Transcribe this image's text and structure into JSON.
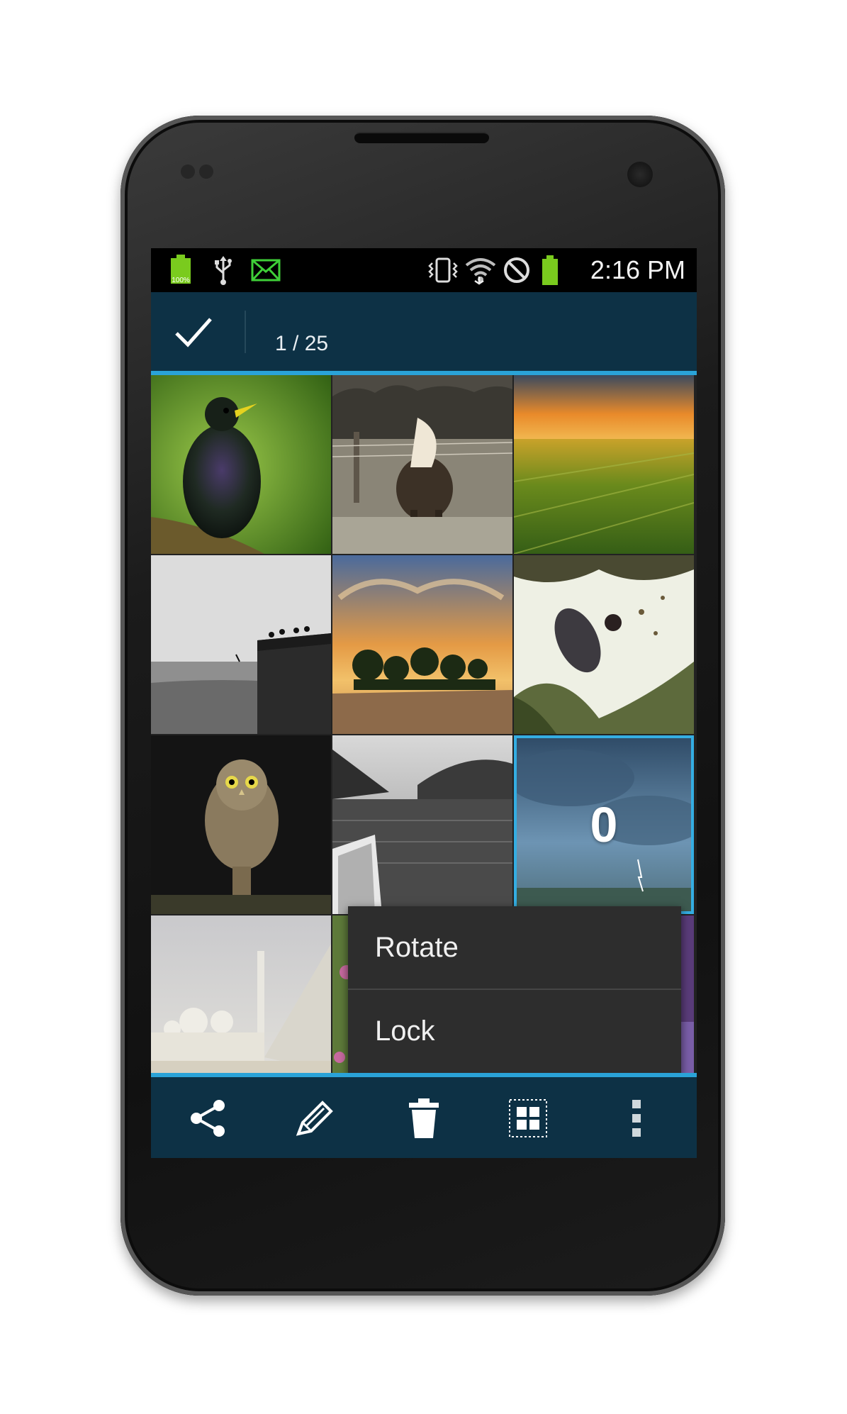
{
  "status_bar": {
    "battery_label": "100%",
    "time": "2:16 PM",
    "icons": [
      "battery-full-icon",
      "usb-icon",
      "mail-icon",
      "vibrate-icon",
      "wifi-icon",
      "blocked-icon",
      "battery-icon"
    ]
  },
  "action_bar": {
    "done_icon": "check-icon",
    "selection_count": "1 / 25"
  },
  "grid": {
    "items": [
      {
        "name": "photo-starling"
      },
      {
        "name": "photo-horse"
      },
      {
        "name": "photo-wheat-field"
      },
      {
        "name": "photo-harbor-bw"
      },
      {
        "name": "photo-sunset-trees"
      },
      {
        "name": "photo-woman-in-frame"
      },
      {
        "name": "photo-owl"
      },
      {
        "name": "photo-lake-canoe"
      },
      {
        "name": "photo-storm",
        "selected": true,
        "selected_label": "0"
      },
      {
        "name": "photo-mosque"
      },
      {
        "name": "photo-flowers"
      },
      {
        "name": "photo-lavender"
      }
    ]
  },
  "popup_menu": {
    "items": [
      "Rotate",
      "Lock"
    ]
  },
  "bottom_bar": {
    "buttons": [
      "share-icon",
      "edit-icon",
      "trash-icon",
      "select-all-icon",
      "overflow-icon"
    ]
  },
  "colors": {
    "bar_background": "#0d3145",
    "accent": "#2aa3d8",
    "menu_background": "#2d2d2d"
  }
}
